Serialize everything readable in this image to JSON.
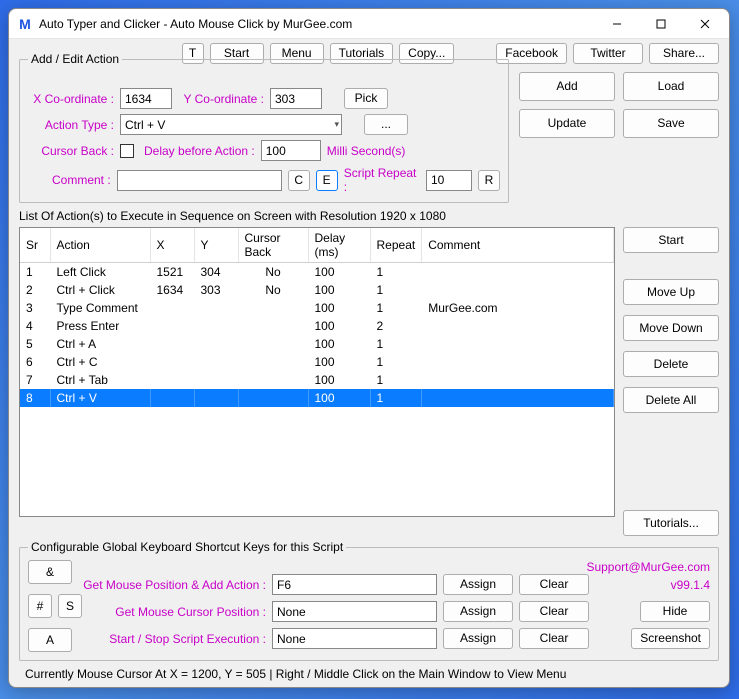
{
  "window": {
    "title": "Auto Typer and Clicker - Auto Mouse Click by MurGee.com",
    "icon_letter": "M"
  },
  "topbar": {
    "t": "T",
    "start": "Start",
    "menu": "Menu",
    "tutorials": "Tutorials",
    "copy": "Copy...",
    "facebook": "Facebook",
    "twitter": "Twitter",
    "share": "Share..."
  },
  "edit": {
    "legend": "Add / Edit Action",
    "x_label": "X Co-ordinate :",
    "x_val": "1634",
    "y_label": "Y Co-ordinate :",
    "y_val": "303",
    "pick": "Pick",
    "action_type_label": "Action Type :",
    "action_type_val": "Ctrl + V",
    "dots": "...",
    "cursor_back_label": "Cursor Back :",
    "delay_label": "Delay before Action :",
    "delay_val": "100",
    "delay_unit": "Milli Second(s)",
    "comment_label": "Comment :",
    "c": "C",
    "e": "E",
    "repeat_label": "Script Repeat :",
    "repeat_val": "10",
    "r": "R"
  },
  "sidebuttons": {
    "add": "Add",
    "load": "Load",
    "update": "Update",
    "save": "Save"
  },
  "listheader": "List Of Action(s) to Execute in Sequence on Screen with Resolution 1920 x 1080",
  "cols": {
    "sr": "Sr",
    "action": "Action",
    "x": "X",
    "y": "Y",
    "cursor": "Cursor Back",
    "delay": "Delay (ms)",
    "repeat": "Repeat",
    "comment": "Comment"
  },
  "rows": [
    {
      "sr": "1",
      "action": "Left Click",
      "x": "1521",
      "y": "304",
      "cursor": "No",
      "delay": "100",
      "repeat": "1",
      "comment": ""
    },
    {
      "sr": "2",
      "action": "Ctrl + Click",
      "x": "1634",
      "y": "303",
      "cursor": "No",
      "delay": "100",
      "repeat": "1",
      "comment": ""
    },
    {
      "sr": "3",
      "action": "Type Comment",
      "x": "",
      "y": "",
      "cursor": "",
      "delay": "100",
      "repeat": "1",
      "comment": "MurGee.com"
    },
    {
      "sr": "4",
      "action": "Press Enter",
      "x": "",
      "y": "",
      "cursor": "",
      "delay": "100",
      "repeat": "2",
      "comment": ""
    },
    {
      "sr": "5",
      "action": "Ctrl + A",
      "x": "",
      "y": "",
      "cursor": "",
      "delay": "100",
      "repeat": "1",
      "comment": ""
    },
    {
      "sr": "6",
      "action": "Ctrl + C",
      "x": "",
      "y": "",
      "cursor": "",
      "delay": "100",
      "repeat": "1",
      "comment": ""
    },
    {
      "sr": "7",
      "action": "Ctrl + Tab",
      "x": "",
      "y": "",
      "cursor": "",
      "delay": "100",
      "repeat": "1",
      "comment": ""
    },
    {
      "sr": "8",
      "action": "Ctrl + V",
      "x": "",
      "y": "",
      "cursor": "",
      "delay": "100",
      "repeat": "1",
      "comment": ""
    }
  ],
  "selected_row_index": 7,
  "listbtns": {
    "start": "Start",
    "moveup": "Move Up",
    "movedown": "Move Down",
    "delete": "Delete",
    "deleteall": "Delete All",
    "tutorials": "Tutorials..."
  },
  "shortcuts": {
    "legend": "Configurable Global Keyboard Shortcut Keys for this Script",
    "support": "Support@MurGee.com",
    "amp": "&",
    "hash": "#",
    "s": "S",
    "a": "A",
    "row1_label": "Get Mouse Position & Add Action :",
    "row1_val": "F6",
    "row2_label": "Get Mouse Cursor Position :",
    "row2_val": "None",
    "row3_label": "Start / Stop Script Execution :",
    "row3_val": "None",
    "assign": "Assign",
    "clear": "Clear",
    "version": "v99.1.4",
    "hide": "Hide",
    "screenshot": "Screenshot"
  },
  "status": "Currently Mouse Cursor At X = 1200, Y = 505 | Right / Middle Click on the Main Window to View Menu"
}
